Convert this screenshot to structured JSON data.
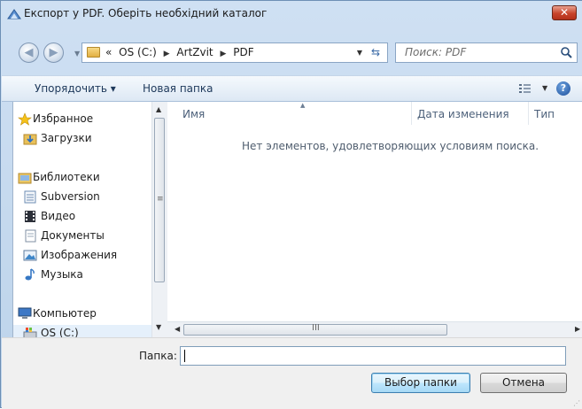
{
  "window": {
    "title": "Експорт у PDF. Оберіть необхідний каталог",
    "close_glyph": "✕"
  },
  "navigation": {
    "breadcrumb_prefix": "«",
    "breadcrumbs": [
      "OS (C:)",
      "ArtZvit",
      "PDF"
    ],
    "search_placeholder": "Поиск: PDF"
  },
  "toolbar": {
    "organize_label": "Упорядочить ▾",
    "new_folder_label": "Новая папка",
    "help_glyph": "?"
  },
  "sidebar": {
    "items": [
      {
        "label": "Избранное",
        "icon": "star-icon"
      },
      {
        "label": "Загрузки",
        "icon": "downloads-folder-icon"
      },
      {
        "label": "Библиотеки",
        "icon": "libraries-icon"
      },
      {
        "label": "Subversion",
        "icon": "document-library-icon"
      },
      {
        "label": "Видео",
        "icon": "video-icon"
      },
      {
        "label": "Документы",
        "icon": "documents-icon"
      },
      {
        "label": "Изображения",
        "icon": "pictures-icon"
      },
      {
        "label": "Музыка",
        "icon": "music-icon"
      },
      {
        "label": "Компьютер",
        "icon": "computer-icon"
      },
      {
        "label": "OS (C:)",
        "icon": "drive-icon"
      }
    ]
  },
  "file_list": {
    "columns": [
      "Имя",
      "Дата изменения",
      "Тип"
    ],
    "empty_message": "Нет элементов, удовлетворяющих условиям поиска."
  },
  "footer": {
    "folder_label": "Папка:",
    "folder_value": "",
    "select_button": "Выбор папки",
    "cancel_button": "Отмена"
  }
}
